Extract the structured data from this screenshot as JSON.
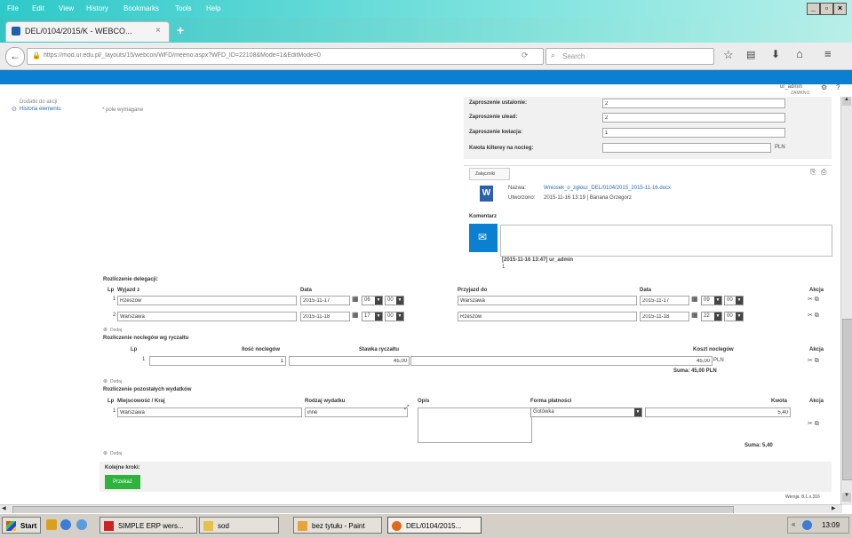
{
  "menu": {
    "file": "File",
    "edit": "Edit",
    "view": "View",
    "history": "History",
    "bookmarks": "Bookmarks",
    "tools": "Tools",
    "help": "Help"
  },
  "tab": {
    "title": "DEL/0104/2015/K - WEBCO...",
    "close": "×",
    "new": "+"
  },
  "nav": {
    "url": "https://mod.ur.edu.pl/_layouts/15/webcon/WFD/meeno.aspx?WFD_ID=22108&Mode=1&EditMode=0",
    "search_placeholder": "Search"
  },
  "user": {
    "name": "ur_admin",
    "gear": "⚙",
    "help": "?"
  },
  "sub": {
    "right": "ZAMKNIJ"
  },
  "left": {
    "item1": "Dodatki do akcji",
    "item2": "Historia elementu",
    "note": "* pole wymagane"
  },
  "top_form": {
    "l1": "Zaproszenie ustalonie:",
    "v1": "2",
    "l2": "Zaproszenie ulead:",
    "v2": "2",
    "l3": "Zaproszenie kwiacja:",
    "v3": "1",
    "l4": "Kwota kilterey na nocleg:",
    "v4": "",
    "u4": "PLN"
  },
  "attachments": {
    "header": "Załączniki",
    "name_label": "Nazwa:",
    "name_value": "Wniosek_o_zgłosz_DEL/0104/2015_2015-11-16.docx",
    "added_label": "Utworzono:",
    "added_value": "2015-11-16 13:19 | Banana Grzegorz"
  },
  "comments": {
    "label": "Komentarz",
    "entry": "[2015-11-16 13:47] ur_admin",
    "entry2": "1"
  },
  "travel": {
    "header": "Rozliczenie delegacji:",
    "col_lp": "Lp",
    "col_from": "Wyjazd z",
    "col_date": "Data",
    "col_to": "Przyjazd do",
    "col_date2": "Data",
    "col_action": "Akcja",
    "rows": [
      {
        "lp": "1",
        "from": "Rzeszów",
        "date": "2015-11-17",
        "h": "06",
        "m": "00",
        "to": "Warszawa",
        "date2": "2015-11-17",
        "h2": "09",
        "m2": "00"
      },
      {
        "lp": "2",
        "from": "Warszawa",
        "date": "2015-11-18",
        "h": "17",
        "m": "00",
        "to": "Rzeszów",
        "date2": "2015-11-18",
        "h2": "22",
        "m2": "00"
      }
    ],
    "add": "Dodaj"
  },
  "lodging": {
    "header": "Rozliczenie noclegów wg ryczałtu",
    "col_lp": "Lp",
    "col_nights": "Ilość noclegów",
    "col_rate": "Stawka ryczałtu",
    "col_cost": "Koszt noclegów",
    "col_action": "Akcja",
    "rows": [
      {
        "lp": "1",
        "nights": "1",
        "rate": "45,00",
        "cost": "45,00",
        "unit": "PLN"
      }
    ],
    "sum": "Suma: 45,00 PLN",
    "add": "Dodaj"
  },
  "other": {
    "header": "Rozliczenie pozostałych wydatków",
    "col_lp": "Lp",
    "col_place": "Miejscowość / Kraj",
    "col_type": "Rodzaj wydatku",
    "col_desc": "Opis",
    "col_pay": "Forma płatności",
    "col_amount": "Kwota",
    "col_action": "Akcja",
    "rows": [
      {
        "lp": "1",
        "place": "Warszawa",
        "type": "inne",
        "pay": "Gotówka",
        "amount": "5,40"
      }
    ],
    "sum": "Suma: 5,40",
    "add": "Dodaj"
  },
  "next": {
    "label": "Kolejne kroki:",
    "button": "Przekaż"
  },
  "version": "Wersja: 8.1.x.316",
  "taskbar": {
    "start": "Start",
    "t1": "SIMPLE ERP wers...",
    "t2": "sod",
    "t3": "bez tytułu - Paint",
    "t4": "DEL/0104/2015...",
    "clock": "13:09"
  },
  "colors": {
    "title_start": "#2ec9c9",
    "blue_bar": "#0b7fd0",
    "button_green": "#2fb33c"
  }
}
